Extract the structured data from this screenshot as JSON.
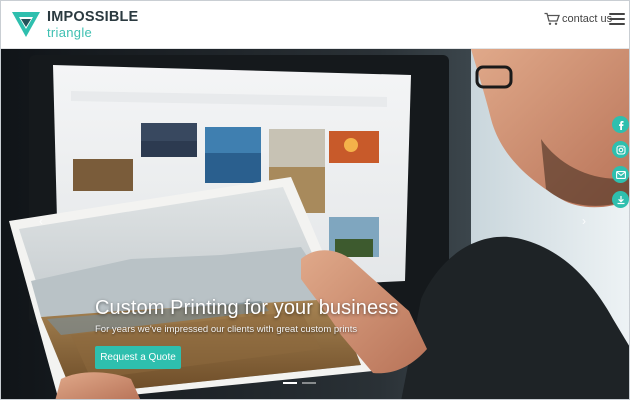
{
  "brand": {
    "name_line1": "IMPOSSIBLE",
    "name_line2": "triangle",
    "colors": {
      "teal": "#2ebfae",
      "dark": "#2b3a40"
    }
  },
  "header": {
    "contact_label": "contact us",
    "icons": [
      "cart-icon",
      "menu-icon"
    ]
  },
  "hero": {
    "title": "Custom Printing for your business",
    "subtitle": "For years we've impressed our clients with great custom prints",
    "cta_label": "Request a Quote",
    "prev_arrow": "‹",
    "next_arrow": "›",
    "slides_total": 2,
    "active_slide": 1
  },
  "social": [
    "facebook-icon",
    "instagram-icon",
    "email-icon",
    "download-icon"
  ]
}
